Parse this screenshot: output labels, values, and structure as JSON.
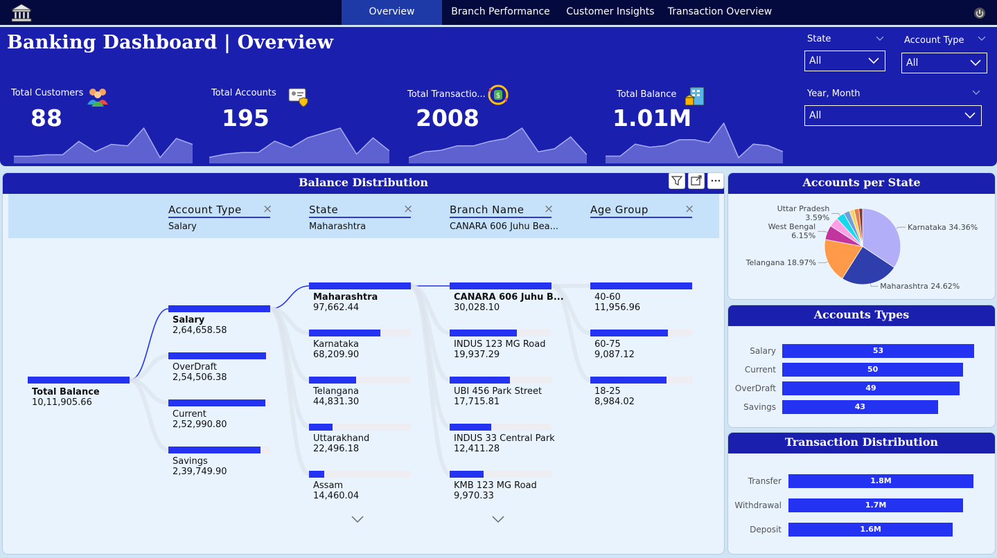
{
  "nav": {
    "tabs": [
      {
        "label": "Overview",
        "active": true
      },
      {
        "label": "Branch Performance",
        "active": false
      },
      {
        "label": "Customer Insights",
        "active": false
      },
      {
        "label": "Transaction Overview",
        "active": false
      }
    ]
  },
  "header": {
    "title": "Banking Dashboard | Overview",
    "kpis": [
      {
        "label": "Total Customers",
        "value": "88",
        "icon": "customers-icon",
        "trend": [
          3,
          3,
          4,
          4,
          13,
          6,
          11,
          10,
          22,
          2,
          15,
          11
        ]
      },
      {
        "label": "Total Accounts",
        "value": "195",
        "icon": "account-card-icon",
        "trend": [
          2,
          4,
          5,
          5,
          12,
          8,
          14,
          17,
          20,
          4,
          14,
          6
        ]
      },
      {
        "label": "Total Transactio...",
        "value": "2008",
        "icon": "money-cycle-icon",
        "trend": [
          2,
          6,
          7,
          10,
          10,
          13,
          15,
          22,
          6,
          8,
          16,
          4
        ]
      },
      {
        "label": "Total Balance",
        "value": "1.01M",
        "icon": "bank-building-icon",
        "trend": [
          3,
          3,
          11,
          9,
          10,
          14,
          14,
          12,
          25,
          2,
          11,
          10,
          6
        ]
      }
    ],
    "slicers": {
      "state": {
        "label": "State",
        "value": "All"
      },
      "account_type": {
        "label": "Account Type",
        "value": "All"
      },
      "year_month": {
        "label": "Year, Month",
        "value": "All"
      }
    }
  },
  "balance_distribution": {
    "title": "Balance Distribution",
    "root": {
      "name": "Total Balance",
      "value": "10,11,905.66"
    },
    "levels": [
      {
        "title": "Account Type",
        "selected": "Salary",
        "nodes": [
          {
            "name": "Salary",
            "value": "2,64,658.58",
            "share": 1.0
          },
          {
            "name": "OverDraft",
            "value": "2,54,506.38",
            "share": 0.96
          },
          {
            "name": "Current",
            "value": "2,52,990.80",
            "share": 0.955
          },
          {
            "name": "Savings",
            "value": "2,39,749.90",
            "share": 0.905
          }
        ]
      },
      {
        "title": "State",
        "selected": "Maharashtra",
        "nodes": [
          {
            "name": "Maharashtra",
            "value": "97,662.44",
            "share": 1.0
          },
          {
            "name": "Karnataka",
            "value": "68,209.90",
            "share": 0.7
          },
          {
            "name": "Telangana",
            "value": "44,831.30",
            "share": 0.46
          },
          {
            "name": "Uttarakhand",
            "value": "22,496.18",
            "share": 0.23
          },
          {
            "name": "Assam",
            "value": "14,460.04",
            "share": 0.15
          }
        ]
      },
      {
        "title": "Branch Name",
        "selected": "CANARA 606 Juhu Bea...",
        "nodes": [
          {
            "name": "CANARA 606 Juhu B...",
            "value": "30,028.10",
            "share": 1.0
          },
          {
            "name": "INDUS 123 MG Road",
            "value": "19,937.29",
            "share": 0.66
          },
          {
            "name": "UBI 456 Park Street",
            "value": "17,715.81",
            "share": 0.59
          },
          {
            "name": "INDUS 33 Central Park",
            "value": "12,411.28",
            "share": 0.41
          },
          {
            "name": "KMB 123 MG Road",
            "value": "9,970.33",
            "share": 0.33
          }
        ]
      },
      {
        "title": "Age Group",
        "selected": "",
        "nodes": [
          {
            "name": "40-60",
            "value": "11,956.96",
            "share": 1.0
          },
          {
            "name": "60-75",
            "value": "9,087.12",
            "share": 0.76
          },
          {
            "name": "18-25",
            "value": "8,984.02",
            "share": 0.75
          }
        ]
      }
    ]
  },
  "accounts_per_state": {
    "title": "Accounts per State",
    "chart_data": {
      "type": "pie",
      "slices": [
        {
          "label": "Karnataka",
          "value": 34.36,
          "display": "Karnataka 34.36%",
          "color": "#b3aef8"
        },
        {
          "label": "Maharashtra",
          "value": 24.62,
          "display": "Maharashtra 24.62%",
          "color": "#2e3eac"
        },
        {
          "label": "Telangana",
          "value": 18.97,
          "display": "Telangana 18.97%",
          "color": "#ff9a4a"
        },
        {
          "label": "West Bengal",
          "value": 6.15,
          "display": "West Bengal\n6.15%",
          "color": "#c2359e"
        },
        {
          "label": "",
          "value": 4.1,
          "color": "#ffa0e6"
        },
        {
          "label": "Uttar Pradesh",
          "value": 3.59,
          "display": "Uttar Pradesh\n3.59%",
          "color": "#16d9f0"
        },
        {
          "label": "",
          "value": 2.56,
          "color": "#6fa0d8"
        },
        {
          "label": "",
          "value": 2.05,
          "color": "#f7d26a"
        },
        {
          "label": "",
          "value": 2.05,
          "color": "#e87d4a"
        },
        {
          "label": "",
          "value": 1.55,
          "color": "#7c3a3a"
        }
      ]
    }
  },
  "accounts_types": {
    "title": "Accounts Types",
    "chart_data": {
      "type": "bar",
      "orientation": "horizontal",
      "categories": [
        "Salary",
        "Current",
        "OverDraft",
        "Savings"
      ],
      "values": [
        53,
        50,
        49,
        43
      ],
      "labels": [
        "53",
        "50",
        "49",
        "43"
      ],
      "color": "#2433f2"
    }
  },
  "transaction_distribution": {
    "title": "Transaction Distribution",
    "chart_data": {
      "type": "bar",
      "orientation": "horizontal",
      "categories": [
        "Transfer",
        "Withdrawal",
        "Deposit"
      ],
      "values": [
        1.8,
        1.7,
        1.6
      ],
      "labels": [
        "1.8M",
        "1.7M",
        "1.6M"
      ],
      "unit": "M",
      "color": "#2433f2"
    }
  }
}
